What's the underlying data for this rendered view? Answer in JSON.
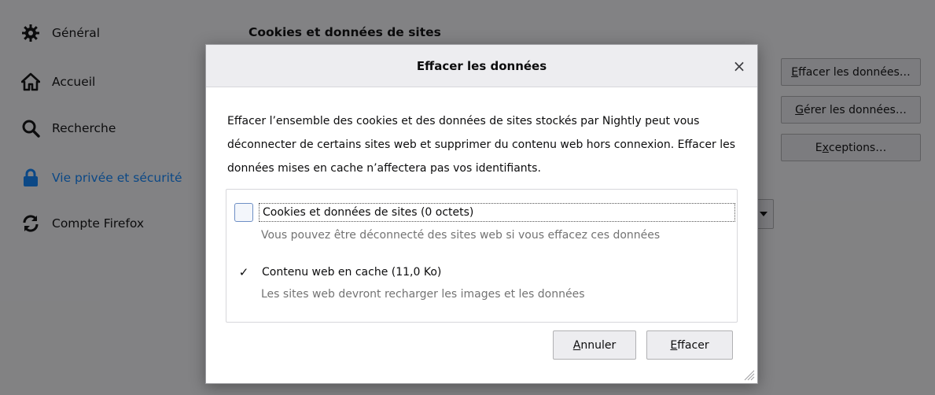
{
  "sidebar": {
    "items": [
      {
        "label": "Général",
        "icon": "gear-icon"
      },
      {
        "label": "Accueil",
        "icon": "home-icon"
      },
      {
        "label": "Recherche",
        "icon": "search-icon"
      },
      {
        "label": "Vie privée et sécurité",
        "icon": "lock-icon",
        "selected": true
      },
      {
        "label": "Compte Firefox",
        "icon": "sync-icon"
      }
    ]
  },
  "main": {
    "section_title": "Cookies et données de sites",
    "buttons": {
      "clear_data": {
        "before": "",
        "accel": "E",
        "after": "ffacer les données…"
      },
      "manage_data": {
        "before": "",
        "accel": "G",
        "after": "érer les données…"
      },
      "exceptions": {
        "before": "E",
        "accel": "x",
        "after": "ceptions…"
      }
    }
  },
  "dialog": {
    "title": "Effacer les données",
    "close_glyph": "×",
    "description": "Effacer l’ensemble des cookies et des données de sites stockés par Nightly peut vous déconnecter de certains sites web et supprimer du contenu web hors connexion. Effacer les données mises en cache n’affectera pas vos identifiants.",
    "options": {
      "cookies": {
        "label": "Cookies et données de sites (0 octets)",
        "sublabel": "Vous pouvez être déconnecté des sites web si vous effacez ces données",
        "checked": false
      },
      "cache": {
        "label": "Contenu web en cache (11,0 Ko)",
        "sublabel": "Les sites web devront recharger les images et les données",
        "checked": true,
        "check_glyph": "✓"
      }
    },
    "buttons": {
      "cancel": {
        "accel": "A",
        "rest": "nnuler"
      },
      "clear": {
        "accel": "E",
        "rest": "ffacer"
      }
    }
  },
  "colors": {
    "accent": "#0a84ff",
    "overlay": "rgba(12,12,13,0.50)"
  }
}
